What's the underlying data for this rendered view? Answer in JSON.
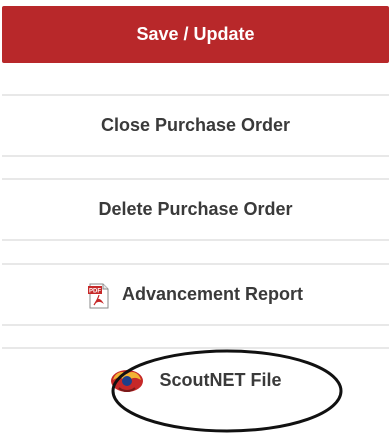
{
  "actions": {
    "save_label": "Save / Update",
    "close_label": "Close Purchase Order",
    "delete_label": "Delete Purchase Order",
    "advancement_label": "Advancement Report",
    "advancement_icon": "pdf-icon",
    "scoutnet_label": "ScoutNET File",
    "scoutnet_icon": "scoutnet-icon"
  },
  "icon_text": {
    "pdf_badge": "PDF"
  },
  "colors": {
    "primary": "#b8282a",
    "primary_text": "#ffffff",
    "secondary_text": "#3a3a3a",
    "divider": "#e8e8e8"
  }
}
